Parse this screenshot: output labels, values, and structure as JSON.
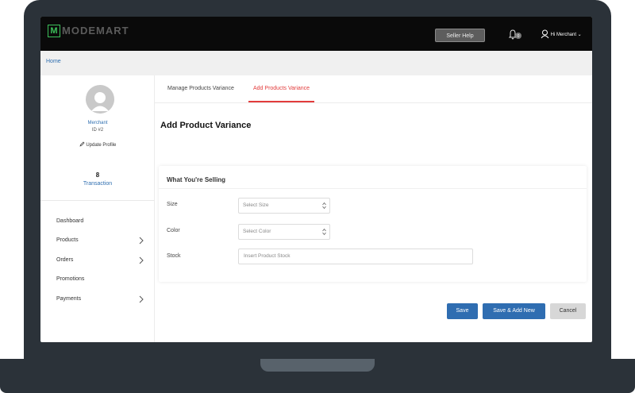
{
  "brand": {
    "logo_letter": "M",
    "name": "MODEMART"
  },
  "header": {
    "help_label": "Seller Help",
    "notification_count": "0",
    "user_label": "Hi Merchant ⌄"
  },
  "breadcrumb": {
    "home": "Home"
  },
  "profile": {
    "name": "Merchant",
    "id": "ID #2",
    "update_label": "Update Profile",
    "transaction_count": "8",
    "transaction_label": "Transaction"
  },
  "sidebar": {
    "items": [
      {
        "label": "Dashboard",
        "has_chevron": false
      },
      {
        "label": "Products",
        "has_chevron": true
      },
      {
        "label": "Orders",
        "has_chevron": true
      },
      {
        "label": "Promotions",
        "has_chevron": false
      },
      {
        "label": "Payments",
        "has_chevron": true
      }
    ]
  },
  "tabs": [
    {
      "label": "Manage Products Variance",
      "active": false
    },
    {
      "label": "Add Products Variance",
      "active": true
    }
  ],
  "page": {
    "title": "Add Product Variance"
  },
  "form": {
    "section_title": "What You're Selling",
    "size": {
      "label": "Size",
      "placeholder": "Select Size"
    },
    "color": {
      "label": "Color",
      "placeholder": "Select Color"
    },
    "stock": {
      "label": "Stock",
      "placeholder": "Insert Product Stock"
    }
  },
  "actions": {
    "save": "Save",
    "save_add_new": "Save & Add New",
    "cancel": "Cancel"
  },
  "colors": {
    "accent": "#2f6db1",
    "active_tab": "#e23b3b",
    "brand_green": "#3cc05a"
  }
}
